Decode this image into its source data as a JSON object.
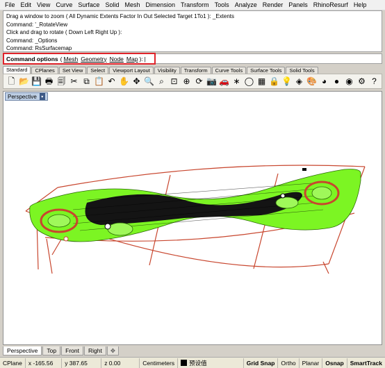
{
  "menu": [
    "File",
    "Edit",
    "View",
    "Curve",
    "Surface",
    "Solid",
    "Mesh",
    "Dimension",
    "Transform",
    "Tools",
    "Analyze",
    "Render",
    "Panels",
    "RhinoResurf",
    "Help"
  ],
  "command_history": [
    "Drag a window to zoom ( All  Dynamic  Extents  Factor  In  Out  Selected  Target  1To1 ): _Extents",
    "Command: '_RotateView",
    "Click and drag to rotate ( Down  Left  Right  Up ):",
    "Command: _Options",
    "Command: RsSurfacemap"
  ],
  "command_prompt": {
    "label": "Command options",
    "open": "(",
    "options": [
      "Mesh",
      "Geometry",
      "Node",
      "Map"
    ],
    "close": "):",
    "caret": "|"
  },
  "toolbar_tabs": [
    "Standard",
    "CPlanes",
    "Set View",
    "Select",
    "Viewport Layout",
    "Visibility",
    "Transform",
    "Curve Tools",
    "Surface Tools",
    "Solid Tools"
  ],
  "toolbar_icons": [
    {
      "name": "new-file-icon",
      "glyph": "🗋"
    },
    {
      "name": "open-folder-icon",
      "glyph": "📂"
    },
    {
      "name": "save-icon",
      "glyph": "💾"
    },
    {
      "name": "print-icon",
      "glyph": "🖶"
    },
    {
      "name": "import-icon",
      "glyph": "🗐"
    },
    {
      "name": "cut-icon",
      "glyph": "✂"
    },
    {
      "name": "copy-icon",
      "glyph": "⧉"
    },
    {
      "name": "paste-icon",
      "glyph": "📋"
    },
    {
      "name": "undo-icon",
      "glyph": "↶"
    },
    {
      "name": "pan-hand-icon",
      "glyph": "✋"
    },
    {
      "name": "move-icon",
      "glyph": "✥"
    },
    {
      "name": "zoom-icon",
      "glyph": "🔍"
    },
    {
      "name": "zoom-window-icon",
      "glyph": "⌕"
    },
    {
      "name": "zoom-extents-icon",
      "glyph": "⊡"
    },
    {
      "name": "zoom-selected-icon",
      "glyph": "⊕"
    },
    {
      "name": "rotate-view-icon",
      "glyph": "⟳"
    },
    {
      "name": "camera-icon",
      "glyph": "📷"
    },
    {
      "name": "car-icon",
      "glyph": "🚗"
    },
    {
      "name": "point-icon",
      "glyph": "∗"
    },
    {
      "name": "circle-icon",
      "glyph": "◯"
    },
    {
      "name": "grid-icon",
      "glyph": "▦"
    },
    {
      "name": "lock-icon",
      "glyph": "🔒"
    },
    {
      "name": "light-bulb-icon",
      "glyph": "💡"
    },
    {
      "name": "layer-icon",
      "glyph": "◈"
    },
    {
      "name": "material-icon",
      "glyph": "🎨"
    },
    {
      "name": "color-wheel-icon",
      "glyph": "◕"
    },
    {
      "name": "sphere-icon",
      "glyph": "●"
    },
    {
      "name": "render-icon",
      "glyph": "◉"
    },
    {
      "name": "settings-gear-icon",
      "glyph": "⚙"
    },
    {
      "name": "help-icon",
      "glyph": "?"
    }
  ],
  "viewport": {
    "title": "Perspective",
    "dropdown": "▾"
  },
  "viewport_tabs": [
    "Perspective",
    "Top",
    "Front",
    "Right"
  ],
  "viewport_tab_add": "✥",
  "status": {
    "cplane": "CPlane",
    "x": "x -165.56",
    "y": "y 387.65",
    "z": "z 0.00",
    "units": "Centimeters",
    "layer": "预设值",
    "grid_snap": "Grid Snap",
    "ortho": "Ortho",
    "planar": "Planar",
    "osnap": "Osnap",
    "smarttrack": "SmartTrack"
  },
  "colors": {
    "mesh_green": "#7cf523",
    "surface_outline": "#c8462e",
    "highlight_box": "#e0242b",
    "wire_black": "#000000"
  }
}
